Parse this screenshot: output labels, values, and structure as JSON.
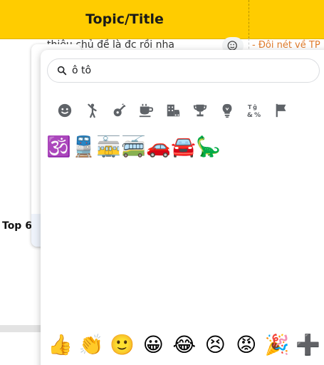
{
  "sheet": {
    "header_title": "Topic/Title",
    "row_text": "thiêu chủ đề là đc rồi nha",
    "row_right_text": "- Đôi nét về TP",
    "side_label": "Top 6"
  },
  "picker": {
    "search": {
      "value": "ô tô",
      "icon": "search-icon"
    },
    "categories": [
      {
        "name": "smileys-icon"
      },
      {
        "name": "people-icon"
      },
      {
        "name": "activities-icon"
      },
      {
        "name": "food-icon"
      },
      {
        "name": "travel-icon"
      },
      {
        "name": "trophy-icon"
      },
      {
        "name": "objects-icon"
      },
      {
        "name": "symbols-icon"
      },
      {
        "name": "flags-icon"
      }
    ],
    "results": [
      "🕉️",
      "🚆",
      "🚋",
      "🚎",
      "🚗",
      "🚘",
      "🦕"
    ],
    "frequent": [
      "👍",
      "👏",
      "🙂",
      "😀",
      "😂",
      "😣",
      "😡",
      "🎉",
      "➕"
    ]
  },
  "colors": {
    "header_yellow": "#ffcc00",
    "icon_gray": "#5f6368",
    "accent_orange": "#e07b2a"
  }
}
